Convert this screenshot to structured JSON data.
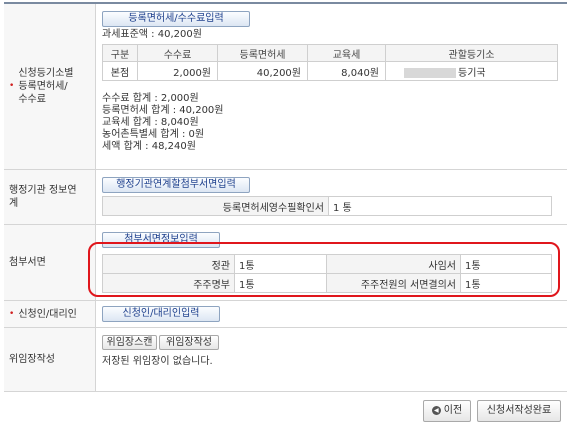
{
  "fee_section": {
    "label": "신청등기소별 등록면허세/수수료",
    "label_line1": "신청등기소별",
    "label_line2": "등록면허세/",
    "label_line3": "수수료",
    "input_button": "등록면허세/수수료입력",
    "tax_base": "과세표준액 : 40,200원",
    "table": {
      "headers": [
        "구분",
        "수수료",
        "등록면허세",
        "교육세",
        "관할등기소"
      ],
      "row": {
        "type": "본점",
        "fee": "2,000원",
        "reg_tax": "40,200원",
        "edu_tax": "8,040원",
        "registry": "등기국"
      }
    },
    "totals": [
      "수수료 합계 : 2,000원",
      "등록면허세 합계 : 40,200원",
      "교육세 합계 : 8,040원",
      "농어촌특별세 합계 : 0원",
      "세액 합계 : 48,240원"
    ]
  },
  "agency_section": {
    "label_line1": "행정기관 정보연",
    "label_line2": "계",
    "input_button": "행정기관연계할첨부서면입력",
    "row": {
      "key": "등록면허세영수필확인서",
      "value": "1 통"
    }
  },
  "attachment_section": {
    "label": "첨부서면",
    "input_button": "첨부서면정보입력",
    "rows": [
      {
        "k1": "정관",
        "v1": "1통",
        "k2": "사임서",
        "v2": "1통"
      },
      {
        "k1": "주주명부",
        "v1": "1통",
        "k2": "주주전원의 서면결의서",
        "v2": "1통"
      }
    ]
  },
  "applicant_section": {
    "label": "신청인/대리인",
    "input_button": "신청인/대리인입력"
  },
  "delegation_section": {
    "label": "위임장작성",
    "scan_button": "위임장스캔",
    "write_button": "위임장작성",
    "status": "저장된 위임장이 없습니다."
  },
  "footer": {
    "prev_button": "이전",
    "prev_icon": "chevron-left-icon",
    "complete_button": "신청서작성완료"
  },
  "colors": {
    "highlight": "#e0161c",
    "required": "#d02020",
    "link": "#1d3f8c"
  }
}
